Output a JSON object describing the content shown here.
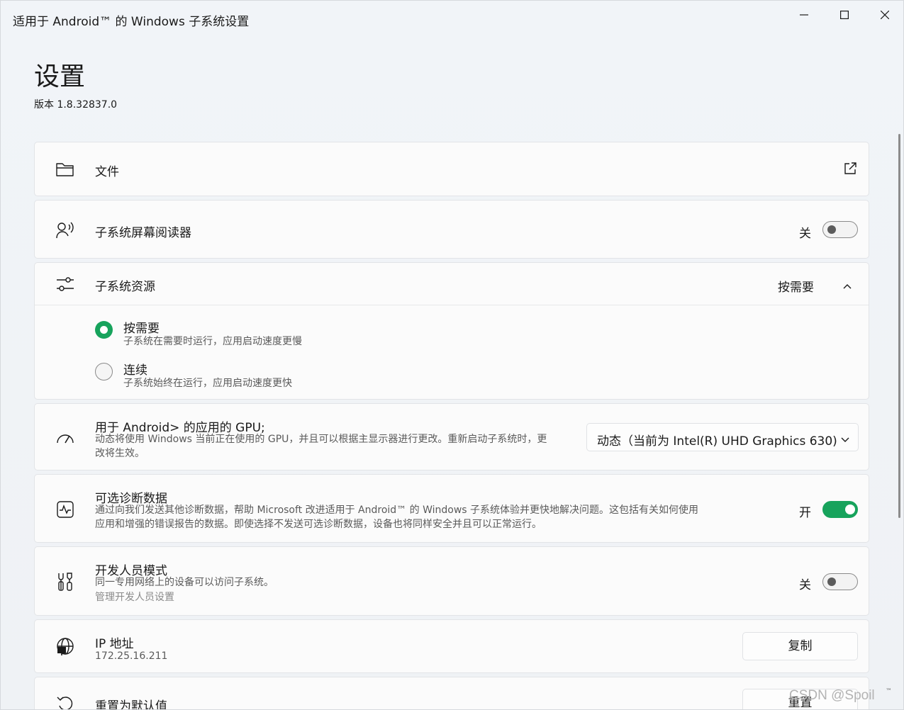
{
  "window": {
    "title": "适用于 Android™ 的 Windows 子系统设置"
  },
  "header": {
    "title": "设置",
    "version": "版本 1.8.32837.0"
  },
  "files": {
    "label": "文件",
    "icon": "folder-icon",
    "action_icon": "open-external-icon"
  },
  "screen_reader": {
    "label": "子系统屏幕阅读器",
    "state_text": "关",
    "on": false
  },
  "resources": {
    "label": "子系统资源",
    "selected": "按需要",
    "options": [
      {
        "title": "按需要",
        "desc": "子系统在需要时运行，应用启动速度更慢",
        "checked": true
      },
      {
        "title": "连续",
        "desc": "子系统始终在运行，应用启动速度更快",
        "checked": false
      }
    ]
  },
  "gpu": {
    "label": "用于 Android> 的应用的 GPU;",
    "desc_line1": "动态将使用 Windows 当前正在使用的 GPU，并且可以根据主显示器进行更改。重新启动子系统时，更",
    "desc_line2": "改将生效。",
    "dropdown_value": "动态（当前为 Intel(R) UHD Graphics 630)"
  },
  "diagnostics": {
    "label": "可选诊断数据",
    "desc_line1": "通过向我们发送其他诊断数据，帮助 Microsoft 改进适用于 Android™ 的 Windows 子系统体验并更快地解决问题。这包括有关如何使用",
    "desc_line2": "应用和增强的错误报告的数据。即使选择不发送可选诊断数据，设备也将同样安全并且可以正常运行。",
    "state_text": "开",
    "on": true
  },
  "developer": {
    "label": "开发人员模式",
    "desc": "同一专用网络上的设备可以访问子系统。",
    "link": "管理开发人员设置",
    "state_text": "关",
    "on": false
  },
  "ip": {
    "label": "IP 地址",
    "value": "172.25.16.211",
    "button": "复制"
  },
  "reset": {
    "label": "重置为默认值",
    "button": "重置"
  },
  "watermark": "CSDN @Spoil",
  "trademark": "™",
  "colors": {
    "accent": "#17a35c",
    "card_bg": "#fbfbfb",
    "page_bg": "#eff2f5"
  }
}
